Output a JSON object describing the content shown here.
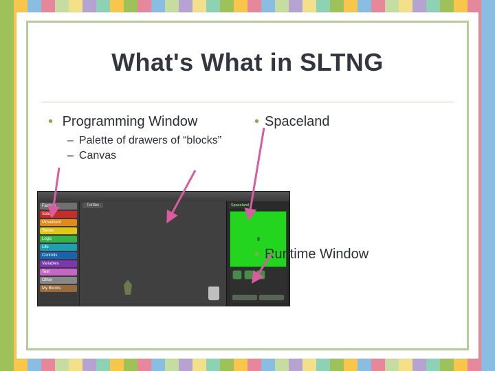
{
  "title": "What's What in SLTNG",
  "left": {
    "heading": "Programming Window",
    "sub": [
      "Palette of drawers of “blocks”",
      "Canvas"
    ]
  },
  "right": {
    "heading": "Spaceland",
    "runtime": "Runtime Window"
  },
  "palette_drawers": [
    {
      "label": "Factory",
      "color": "#707070"
    },
    {
      "label": "Setup",
      "color": "#c62c2c"
    },
    {
      "label": "Movement",
      "color": "#e08a1a"
    },
    {
      "label": "Sense",
      "color": "#e0c81a"
    },
    {
      "label": "Logic",
      "color": "#35b24a"
    },
    {
      "label": "Life",
      "color": "#1aa0b0"
    },
    {
      "label": "Controls",
      "color": "#1a62b0"
    },
    {
      "label": "Variables",
      "color": "#7e35b2"
    },
    {
      "label": "Text",
      "color": "#c666c6"
    },
    {
      "label": "Other",
      "color": "#888888"
    },
    {
      "label": "My Blocks",
      "color": "#9a6b3a"
    }
  ],
  "mock": {
    "canvas_tab": "Turtles",
    "spaceland_tab": "Spaceland"
  },
  "stripe_colors": [
    "#9fc15a",
    "#f6c74b",
    "#8bbde3",
    "#e6879a",
    "#c7dca0",
    "#f2e08a",
    "#b7a3d1",
    "#8dd2b5",
    "#f6c74b",
    "#9fc15a",
    "#e6879a",
    "#8bbde3",
    "#c7dca0",
    "#b7a3d1",
    "#f2e08a",
    "#8dd2b5",
    "#9fc15a",
    "#f6c74b",
    "#e6879a",
    "#8bbde3",
    "#c7dca0",
    "#b7a3d1",
    "#f2e08a",
    "#8dd2b5",
    "#9fc15a",
    "#f6c74b",
    "#8bbde3",
    "#e6879a",
    "#c7dca0",
    "#f2e08a",
    "#b7a3d1",
    "#8dd2b5",
    "#9fc15a",
    "#f6c74b",
    "#e6879a",
    "#8bbde3"
  ],
  "arrow_color": "#d85da0"
}
